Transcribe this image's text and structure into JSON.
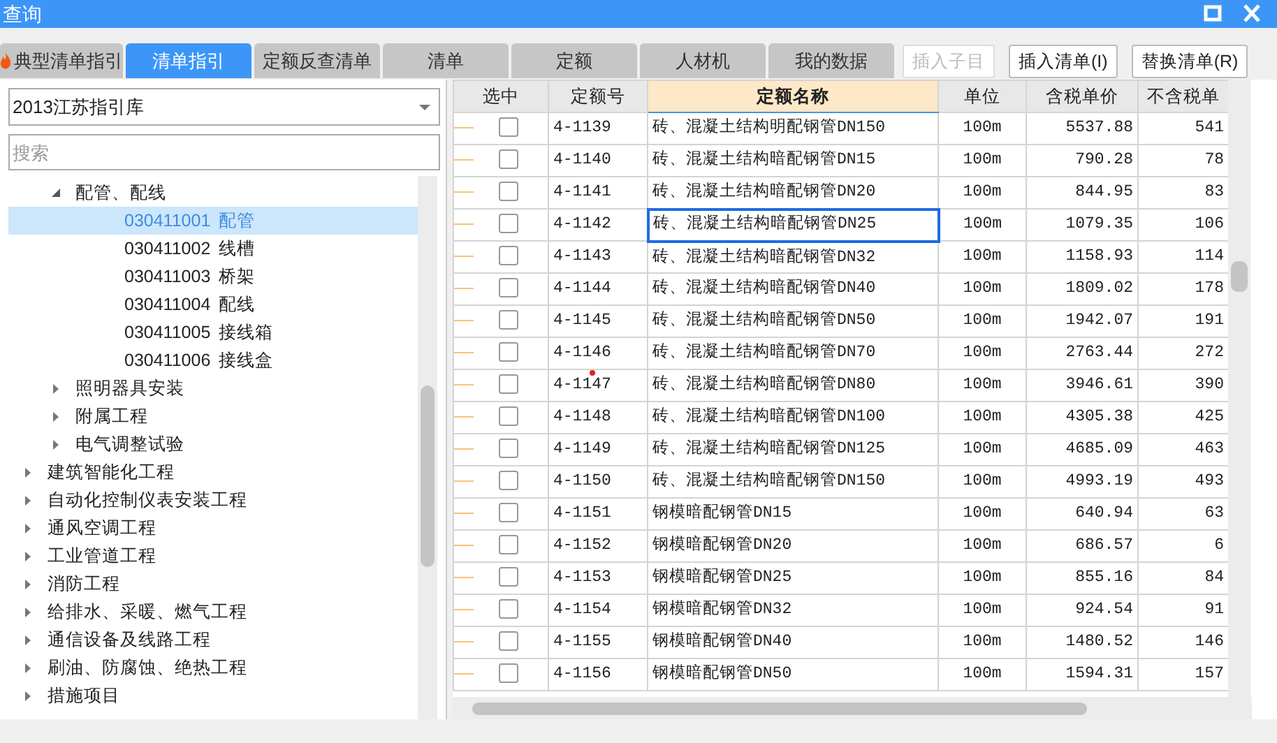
{
  "window": {
    "title": "查询"
  },
  "tabs": [
    {
      "label": "典型清单指引",
      "selected": false
    },
    {
      "label": "清单指引",
      "selected": true
    },
    {
      "label": "定额反查清单",
      "selected": false
    },
    {
      "label": "清单",
      "selected": false
    },
    {
      "label": "定额",
      "selected": false
    },
    {
      "label": "人材机",
      "selected": false
    },
    {
      "label": "我的数据",
      "selected": false
    }
  ],
  "buttons": [
    {
      "label": "插入子目",
      "disabled": true
    },
    {
      "label": "插入清单(I)",
      "disabled": false
    },
    {
      "label": "替换清单(R)",
      "disabled": false
    }
  ],
  "library_select": {
    "value": "2013江苏指引库"
  },
  "search": {
    "placeholder": "搜索"
  },
  "tree": [
    {
      "children": [
        {
          "label": "配管、配线",
          "expanded": true,
          "children": [
            {
              "code": "030411001",
              "name": "配管",
              "selected": true
            },
            {
              "code": "030411002",
              "name": "线槽",
              "selected": false
            },
            {
              "code": "030411003",
              "name": "桥架",
              "selected": false
            },
            {
              "code": "030411004",
              "name": "配线",
              "selected": false
            },
            {
              "code": "030411005",
              "name": "接线箱",
              "selected": false
            },
            {
              "code": "030411006",
              "name": "接线盒",
              "selected": false
            }
          ]
        },
        {
          "label": "照明器具安装",
          "expanded": false
        },
        {
          "label": "附属工程",
          "expanded": false
        },
        {
          "label": "电气调整试验",
          "expanded": false
        }
      ]
    },
    {
      "label": "建筑智能化工程",
      "expanded": false
    },
    {
      "label": "自动化控制仪表安装工程",
      "expanded": false
    },
    {
      "label": "通风空调工程",
      "expanded": false
    },
    {
      "label": "工业管道工程",
      "expanded": false
    },
    {
      "label": "消防工程",
      "expanded": false
    },
    {
      "label": "给排水、采暖、燃气工程",
      "expanded": false
    },
    {
      "label": "通信设备及线路工程",
      "expanded": false
    },
    {
      "label": "刷油、防腐蚀、绝热工程",
      "expanded": false
    },
    {
      "label": "措施项目",
      "expanded": false
    }
  ],
  "table": {
    "columns": [
      "选中",
      "定额号",
      "定额名称",
      "单位",
      "含税单价",
      "不含税单"
    ],
    "rows": [
      {
        "checked": false,
        "code": "4-1139",
        "name": "砖、混凝土结构明配钢管DN150",
        "unit": "100m",
        "price_tax": "5537.88",
        "price_notax": "541",
        "focused": false,
        "marked": false
      },
      {
        "checked": false,
        "code": "4-1140",
        "name": "砖、混凝土结构暗配钢管DN15",
        "unit": "100m",
        "price_tax": "790.28",
        "price_notax": "78",
        "focused": false,
        "marked": false
      },
      {
        "checked": false,
        "code": "4-1141",
        "name": "砖、混凝土结构暗配钢管DN20",
        "unit": "100m",
        "price_tax": "844.95",
        "price_notax": "83",
        "focused": false,
        "marked": false
      },
      {
        "checked": false,
        "code": "4-1142",
        "name": "砖、混凝土结构暗配钢管DN25",
        "unit": "100m",
        "price_tax": "1079.35",
        "price_notax": "106",
        "focused": true,
        "marked": false
      },
      {
        "checked": false,
        "code": "4-1143",
        "name": "砖、混凝土结构暗配钢管DN32",
        "unit": "100m",
        "price_tax": "1158.93",
        "price_notax": "114",
        "focused": false,
        "marked": false
      },
      {
        "checked": false,
        "code": "4-1144",
        "name": "砖、混凝土结构暗配钢管DN40",
        "unit": "100m",
        "price_tax": "1809.02",
        "price_notax": "178",
        "focused": false,
        "marked": false
      },
      {
        "checked": false,
        "code": "4-1145",
        "name": "砖、混凝土结构暗配钢管DN50",
        "unit": "100m",
        "price_tax": "1942.07",
        "price_notax": "191",
        "focused": false,
        "marked": false
      },
      {
        "checked": false,
        "code": "4-1146",
        "name": "砖、混凝土结构暗配钢管DN70",
        "unit": "100m",
        "price_tax": "2763.44",
        "price_notax": "272",
        "focused": false,
        "marked": false
      },
      {
        "checked": false,
        "code": "4-1147",
        "name": "砖、混凝土结构暗配钢管DN80",
        "unit": "100m",
        "price_tax": "3946.61",
        "price_notax": "390",
        "focused": false,
        "marked": true
      },
      {
        "checked": false,
        "code": "4-1148",
        "name": "砖、混凝土结构暗配钢管DN100",
        "unit": "100m",
        "price_tax": "4305.38",
        "price_notax": "425",
        "focused": false,
        "marked": false
      },
      {
        "checked": false,
        "code": "4-1149",
        "name": "砖、混凝土结构暗配钢管DN125",
        "unit": "100m",
        "price_tax": "4685.09",
        "price_notax": "463",
        "focused": false,
        "marked": false
      },
      {
        "checked": false,
        "code": "4-1150",
        "name": "砖、混凝土结构暗配钢管DN150",
        "unit": "100m",
        "price_tax": "4993.19",
        "price_notax": "493",
        "focused": false,
        "marked": false
      },
      {
        "checked": false,
        "code": "4-1151",
        "name": "钢模暗配钢管DN15",
        "unit": "100m",
        "price_tax": "640.94",
        "price_notax": "63",
        "focused": false,
        "marked": false
      },
      {
        "checked": false,
        "code": "4-1152",
        "name": "钢模暗配钢管DN20",
        "unit": "100m",
        "price_tax": "686.57",
        "price_notax": "6",
        "focused": false,
        "marked": false
      },
      {
        "checked": false,
        "code": "4-1153",
        "name": "钢模暗配钢管DN25",
        "unit": "100m",
        "price_tax": "855.16",
        "price_notax": "84",
        "focused": false,
        "marked": false
      },
      {
        "checked": false,
        "code": "4-1154",
        "name": "钢模暗配钢管DN32",
        "unit": "100m",
        "price_tax": "924.54",
        "price_notax": "91",
        "focused": false,
        "marked": false
      },
      {
        "checked": false,
        "code": "4-1155",
        "name": "钢模暗配钢管DN40",
        "unit": "100m",
        "price_tax": "1480.52",
        "price_notax": "146",
        "focused": false,
        "marked": false
      },
      {
        "checked": false,
        "code": "4-1156",
        "name": "钢模暗配钢管DN50",
        "unit": "100m",
        "price_tax": "1594.31",
        "price_notax": "157",
        "focused": false,
        "marked": false
      }
    ]
  }
}
